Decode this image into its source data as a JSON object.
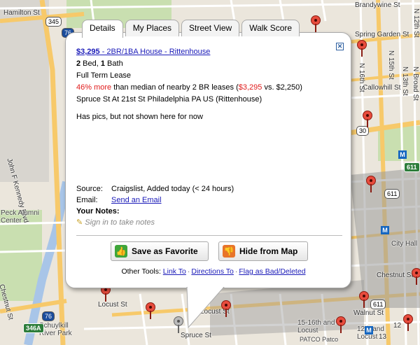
{
  "map": {
    "street_labels": {
      "hamilton": "Hamilton St",
      "brandywine": "Brandywine St",
      "spring_garden": "Spring Garden St",
      "callowhill": "Callowhill St",
      "jfk": "John F Kennedy Blvd",
      "chestnut_left": "Chestnut St",
      "chestnut_right": "Chestnut St",
      "walnut_right": "Walnut St",
      "locust_left": "Locust St",
      "locust_mid": "Locust St",
      "spruce": "Spruce St",
      "n16th": "N 16th St",
      "n15th": "N 15th St",
      "n13th": "N 13th St",
      "n12th": "N 12th St",
      "n_broad": "N Broad St",
      "st_12": "12",
      "st_13": "13"
    },
    "place_labels": {
      "peck": "Peck Alumni Center",
      "city_hall": "City Hall",
      "schuylkill": "Schuylkill River Park",
      "patco_15th": "15-16th and Locust",
      "patco": "PATCO Patco",
      "locust_12": "12th and Locust"
    },
    "route_shields": [
      "345",
      "76",
      "30",
      "611",
      "611",
      "76",
      "346A",
      "611"
    ],
    "metro_letter": "M"
  },
  "tabs": [
    {
      "label": "Details",
      "active": true
    },
    {
      "label": "My Places",
      "active": false
    },
    {
      "label": "Street View",
      "active": false
    },
    {
      "label": "Walk Score",
      "active": false
    }
  ],
  "close_label": "✕",
  "listing": {
    "price": "$3,295",
    "title": " - 2BR/1BA House - Rittenhouse",
    "beds": "2",
    "beds_label": " Bed, ",
    "baths": "1",
    "baths_label": " Bath",
    "lease": "Full Term Lease",
    "comparison_red": "46% more",
    "comparison_text": " than median of nearby 2 BR leases (",
    "comparison_price": "$3,295",
    "comparison_tail": " vs. $2,250)",
    "address": "Spruce St At 21st St Philadelphia PA US (Rittenhouse)",
    "description": "Has pics, but not shown here for now"
  },
  "meta": {
    "source_label": "Source:",
    "source_value": "Craigslist, Added today (< 24 hours)",
    "email_label": "Email:",
    "email_link": "Send an Email",
    "notes_label": "Your Notes:",
    "signin": "Sign in to take notes"
  },
  "actions": {
    "favorite": "Save as Favorite",
    "hide": "Hide from Map"
  },
  "other_tools": {
    "label": "Other Tools:",
    "link_to": "Link To",
    "directions": "Directions To",
    "flag": "Flag as Bad/Deleted"
  },
  "colors": {
    "pin": "#e84c3d",
    "link": "#1a1ab8",
    "warning": "#e01b1b",
    "highway": "#f7c96a",
    "park": "#c9dfb0"
  }
}
